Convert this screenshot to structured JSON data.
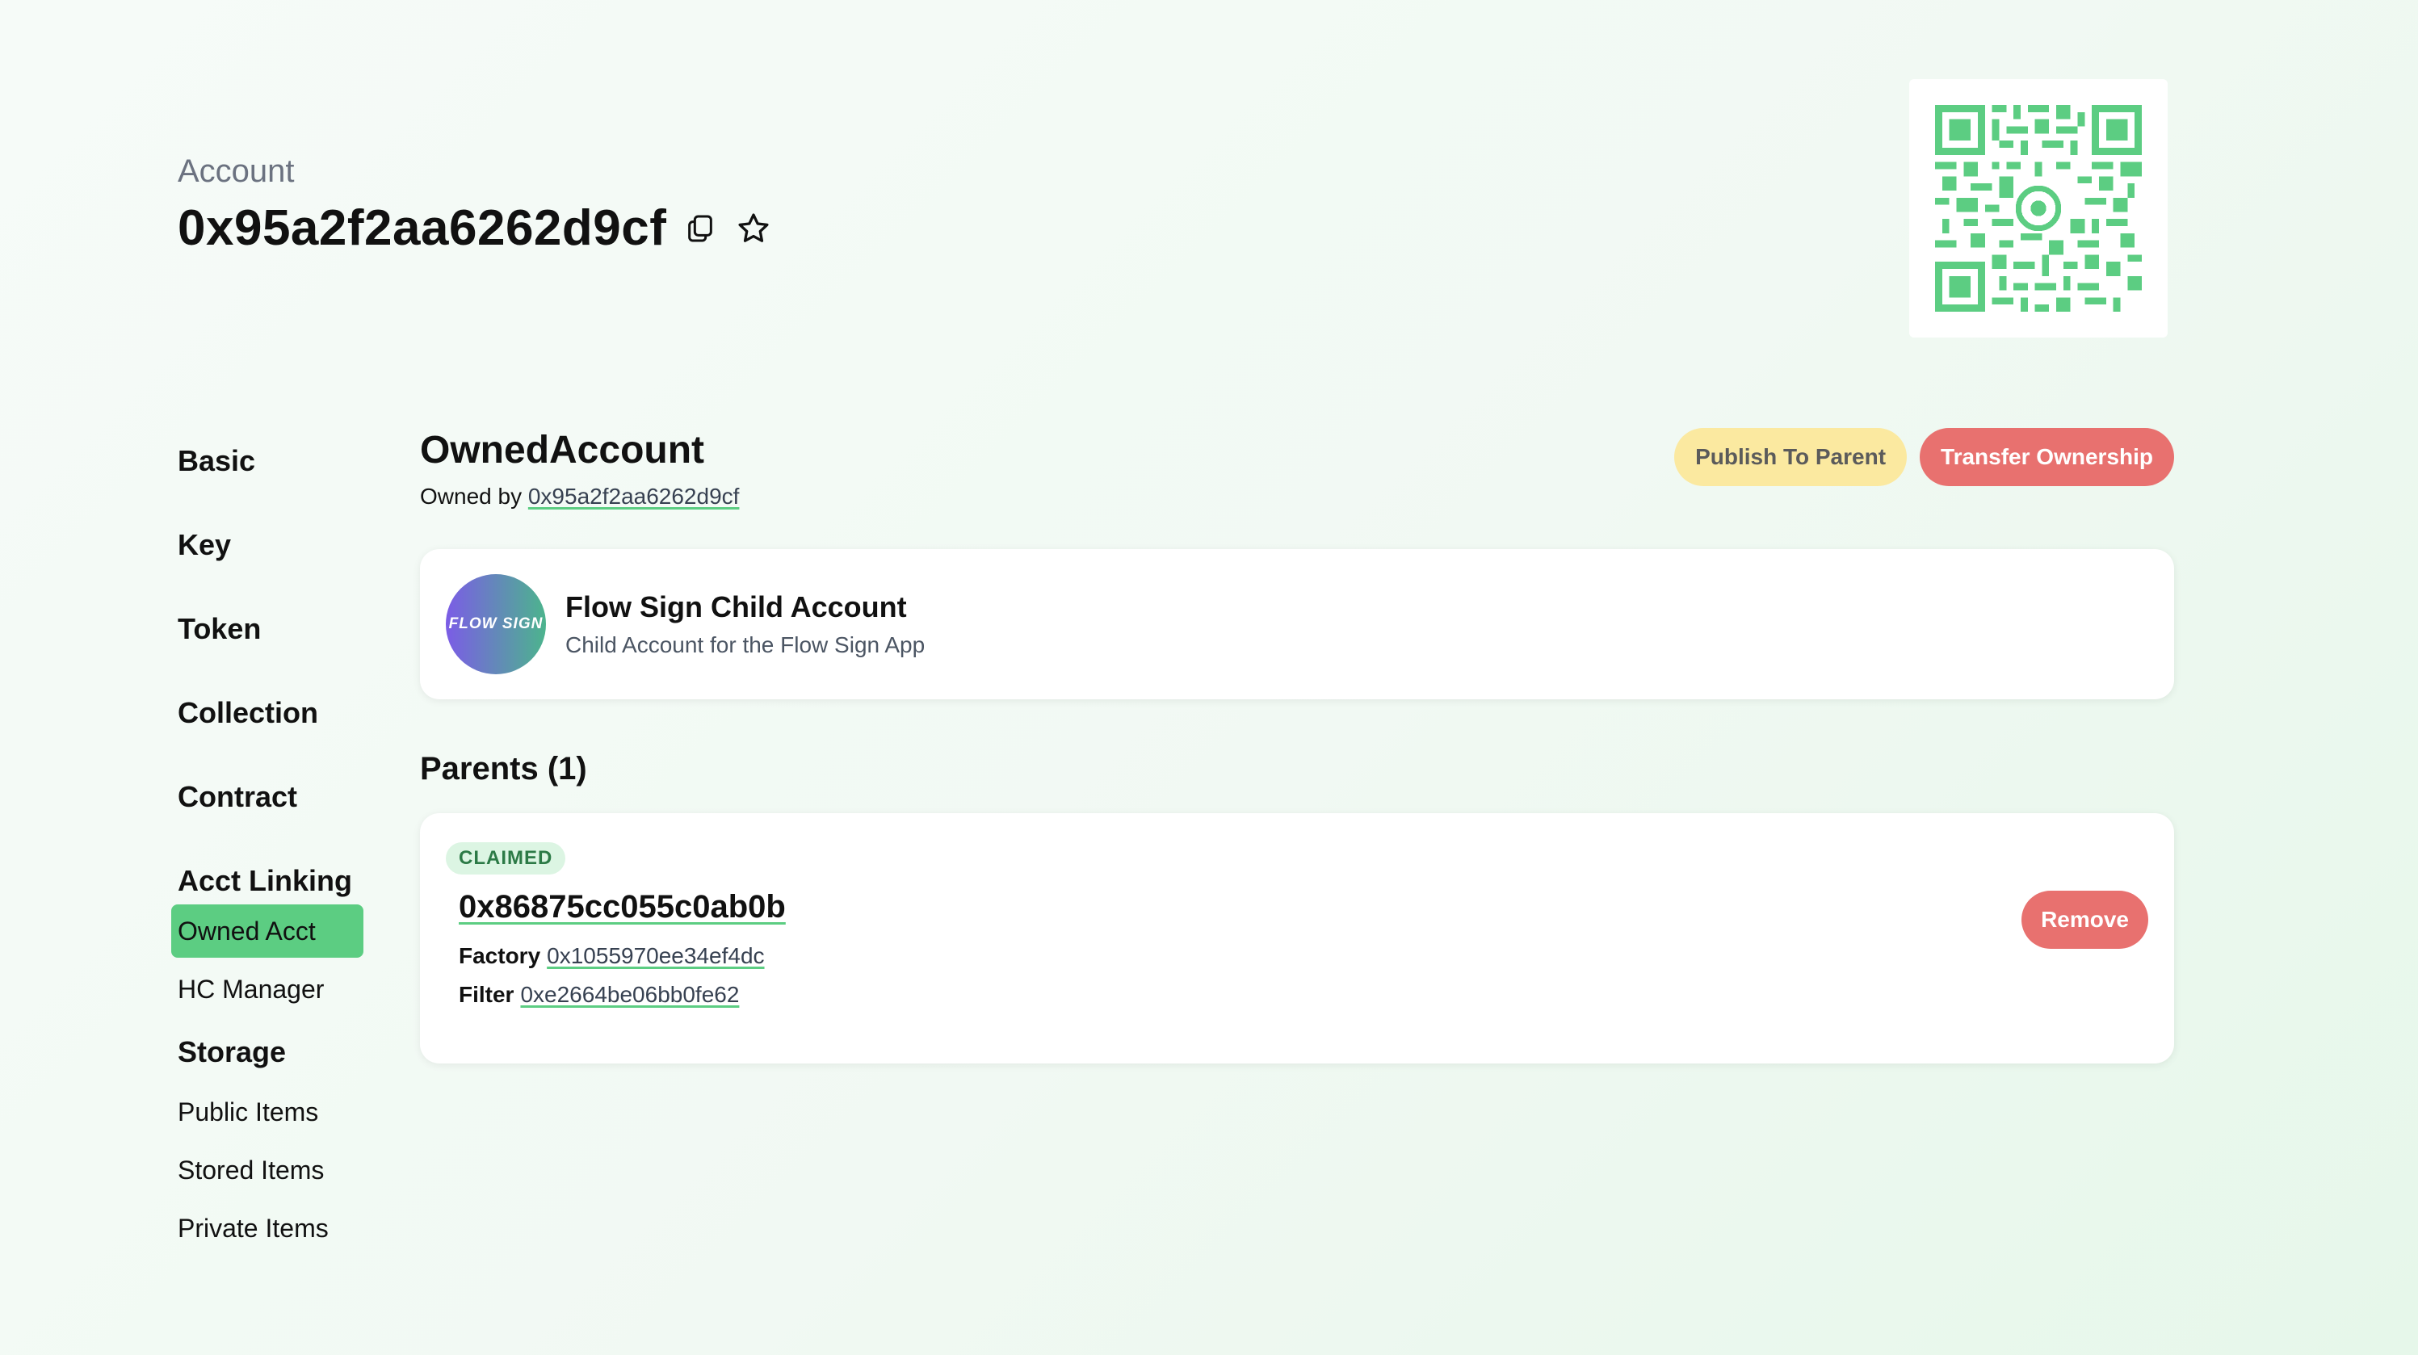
{
  "header": {
    "label": "Account",
    "address": "0x95a2f2aa6262d9cf"
  },
  "icons": {
    "copy": "copy-icon",
    "favorite": "star-icon",
    "qr": "qr-code"
  },
  "sidebar": {
    "sections": [
      {
        "label": "Basic"
      },
      {
        "label": "Key"
      },
      {
        "label": "Token"
      },
      {
        "label": "Collection"
      },
      {
        "label": "Contract"
      },
      {
        "label": "Acct Linking",
        "items": [
          {
            "label": "Owned Acct",
            "active": true
          },
          {
            "label": "HC Manager"
          }
        ]
      },
      {
        "label": "Storage",
        "items": [
          {
            "label": "Public Items"
          },
          {
            "label": "Stored Items"
          },
          {
            "label": "Private Items"
          }
        ]
      }
    ]
  },
  "main": {
    "title": "OwnedAccount",
    "owned_by_label": "Owned by",
    "owned_by_address": "0x95a2f2aa6262d9cf",
    "buttons": {
      "publish": "Publish To Parent",
      "transfer": "Transfer Ownership"
    },
    "child": {
      "avatar_text": "FLOW SIGN",
      "name": "Flow Sign Child Account",
      "description": "Child Account for the Flow Sign App"
    },
    "parents": {
      "title": "Parents (1)",
      "items": [
        {
          "status": "CLAIMED",
          "address": "0x86875cc055c0ab0b",
          "factory_label": "Factory",
          "factory": "0x1055970ee34ef4dc",
          "filter_label": "Filter",
          "filter": "0xe2664be06bb0fe62",
          "remove_label": "Remove"
        }
      ]
    }
  },
  "colors": {
    "accent_green": "#5ccd82",
    "danger_red": "#e8716f",
    "warning_yellow": "#fbe9a0"
  }
}
